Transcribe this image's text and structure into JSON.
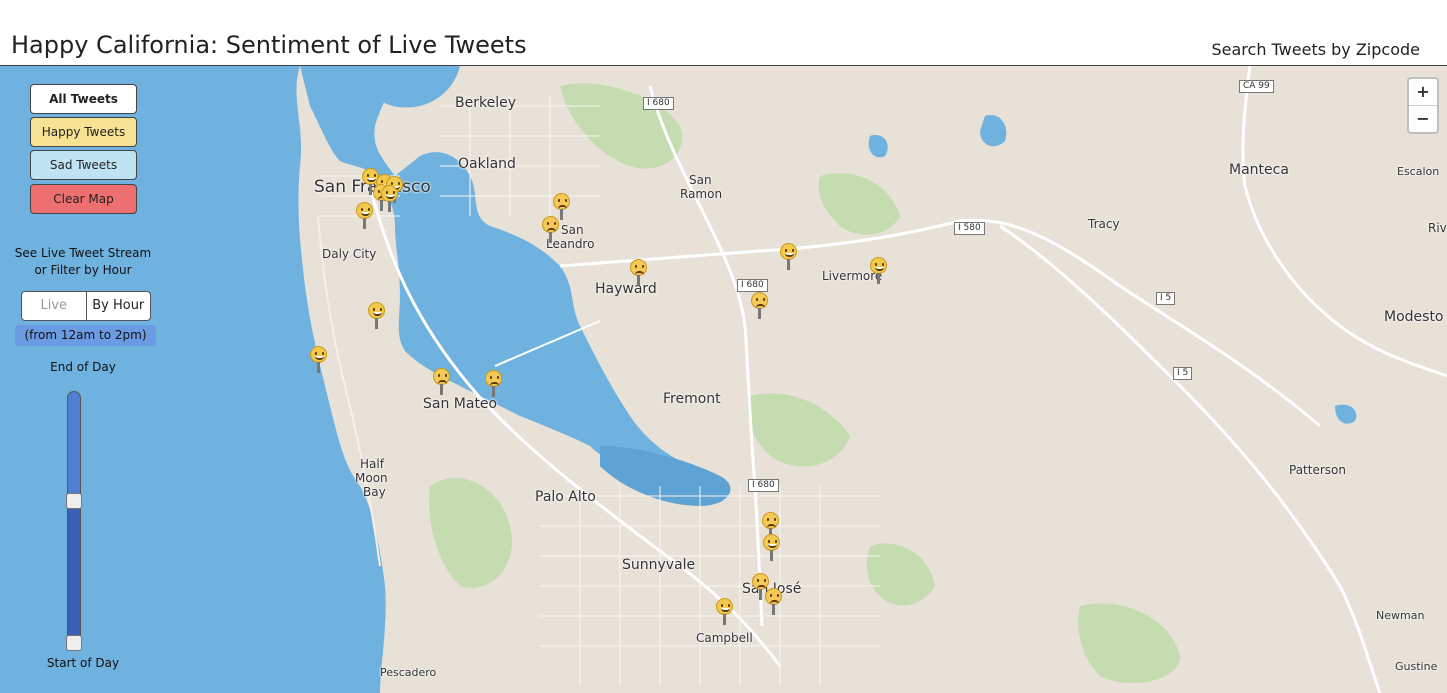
{
  "header": {
    "title": "Happy California: Sentiment of Live Tweets",
    "search_link": "Search Tweets by Zipcode"
  },
  "panel": {
    "buttons": {
      "all": "All Tweets",
      "happy": "Happy Tweets",
      "sad": "Sad Tweets",
      "clear": "Clear Map"
    },
    "stream_text_line1": "See Live Tweet Stream",
    "stream_text_line2": "or Filter by Hour",
    "toggle": {
      "live": "Live",
      "by_hour": "By Hour",
      "selected": "By Hour"
    },
    "hour_range": "(from 12am to 2pm)",
    "slider": {
      "top_label": "End of Day",
      "bottom_label": "Start of Day",
      "start_fraction": 0.0,
      "end_fraction": 0.58
    }
  },
  "map": {
    "zoom": {
      "in": "+",
      "out": "−"
    },
    "places": {
      "berkeley": "Berkeley",
      "oakland": "Oakland",
      "sf": "San Francisco",
      "daly_city": "Daly City",
      "san_leandro_1": "San",
      "san_leandro_2": "Leandro",
      "san_ramon_1": "San",
      "san_ramon_2": "Ramon",
      "hayward": "Hayward",
      "livermore": "Livermore",
      "tracy": "Tracy",
      "manteca": "Manteca",
      "escalon": "Escalon",
      "modesto": "Modesto",
      "riv": "Riv",
      "san_mateo": "San Mateo",
      "fremont": "Fremont",
      "half_moon_1": "Half",
      "half_moon_2": "Moon",
      "half_moon_3": "Bay",
      "palo_alto": "Palo Alto",
      "sunnyvale": "Sunnyvale",
      "san_jose": "San José",
      "campbell": "Campbell",
      "patterson": "Patterson",
      "newman": "Newman",
      "gustine": "Gustine",
      "pescadero": "Pescadero"
    },
    "shields": {
      "i680_north": "I 680",
      "ca99": "CA 99",
      "i580": "I 580",
      "i680_mid": "I 680",
      "i5_a": "I 5",
      "i5_b": "I 5",
      "i680_south": "I 680"
    },
    "tweets": [
      {
        "sentiment": "happy"
      },
      {
        "sentiment": "happy"
      },
      {
        "sentiment": "happy"
      },
      {
        "sentiment": "sad"
      },
      {
        "sentiment": "happy"
      },
      {
        "sentiment": "happy"
      },
      {
        "sentiment": "sad"
      },
      {
        "sentiment": "sad"
      },
      {
        "sentiment": "happy"
      },
      {
        "sentiment": "sad"
      },
      {
        "sentiment": "sad"
      },
      {
        "sentiment": "happy"
      },
      {
        "sentiment": "happy"
      },
      {
        "sentiment": "happy"
      },
      {
        "sentiment": "sad"
      },
      {
        "sentiment": "sad"
      },
      {
        "sentiment": "sad"
      },
      {
        "sentiment": "happy"
      },
      {
        "sentiment": "sad"
      },
      {
        "sentiment": "happy"
      },
      {
        "sentiment": "sad"
      }
    ]
  }
}
